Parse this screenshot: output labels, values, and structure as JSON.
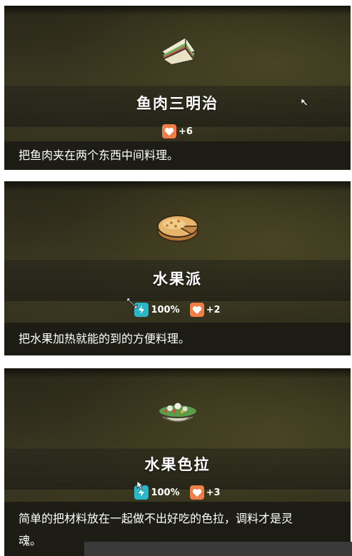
{
  "cards": [
    {
      "icon": "sandwich-icon",
      "title": "鱼肉三明治",
      "stats": [
        {
          "icon": "heart-icon",
          "value": "+6"
        }
      ],
      "description": "把鱼肉夹在两个东西中间料理。"
    },
    {
      "icon": "pie-icon",
      "title": "水果派",
      "stats": [
        {
          "icon": "energy-icon",
          "value": "100%"
        },
        {
          "icon": "heart-icon",
          "value": "+2"
        }
      ],
      "description": "把水果加热就能的到的方便料理。"
    },
    {
      "icon": "salad-bowl-icon",
      "title": "水果色拉",
      "stats": [
        {
          "icon": "energy-icon",
          "value": "100%"
        },
        {
          "icon": "heart-icon",
          "value": "+3"
        }
      ],
      "description_lines": [
        "简单的把材料放在一起做不出好吃的色拉，调料才是灵",
        "魂。"
      ]
    }
  ],
  "colors": {
    "heart": "#f07e48",
    "energy": "#29b7c9"
  }
}
